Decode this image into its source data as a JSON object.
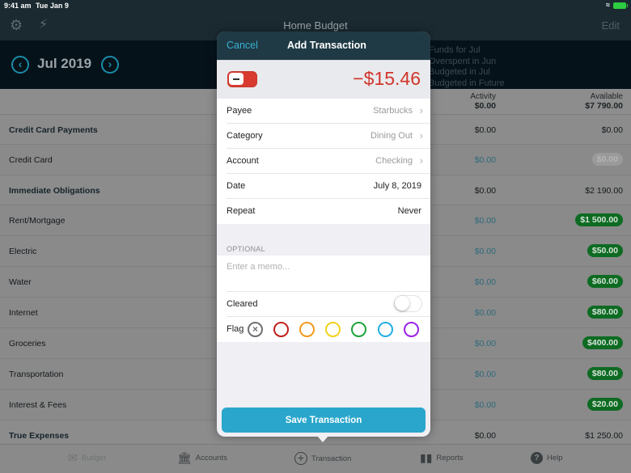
{
  "status_bar": {
    "time": "9:41 am",
    "date": "Tue Jan 9",
    "wifi_icon": "wifi-icon",
    "battery_icon": "battery-charging-icon"
  },
  "nav": {
    "title": "Home Budget",
    "edit_label": "Edit",
    "settings_icon": "gear-icon",
    "quick_icon": "lightning-icon"
  },
  "month": {
    "label": "Jul 2019",
    "prev_icon": "chevron-left-circle-icon",
    "next_icon": "chevron-right-circle-icon"
  },
  "summary_lines": [
    "Funds for Jul",
    "Overspent in Jun",
    "Budgeted in Jul",
    "Budgeted in Future"
  ],
  "columns": {
    "activity": {
      "label": "Activity",
      "total": "$0.00"
    },
    "available": {
      "label": "Available",
      "total": "$7 790.00"
    }
  },
  "rows": [
    {
      "type": "group",
      "name": "Credit Card Payments",
      "activity": "$0.00",
      "available": "$0.00",
      "pill": "none"
    },
    {
      "type": "item",
      "name": "Credit Card",
      "activity": "$0.00",
      "available": "$0.00",
      "pill": "gray"
    },
    {
      "type": "group",
      "name": "Immediate Obligations",
      "activity": "$0.00",
      "available": "$2 190.00",
      "pill": "none"
    },
    {
      "type": "item",
      "name": "Rent/Mortgage",
      "activity": "$0.00",
      "available": "$1 500.00",
      "pill": "green"
    },
    {
      "type": "item",
      "name": "Electric",
      "activity": "$0.00",
      "available": "$50.00",
      "pill": "green"
    },
    {
      "type": "item",
      "name": "Water",
      "activity": "$0.00",
      "available": "$60.00",
      "pill": "green"
    },
    {
      "type": "item",
      "name": "Internet",
      "activity": "$0.00",
      "available": "$80.00",
      "pill": "green"
    },
    {
      "type": "item",
      "name": "Groceries",
      "activity": "$0.00",
      "available": "$400.00",
      "pill": "green"
    },
    {
      "type": "item",
      "name": "Transportation",
      "activity": "$0.00",
      "available": "$80.00",
      "pill": "green"
    },
    {
      "type": "item",
      "name": "Interest & Fees",
      "activity": "$0.00",
      "available": "$20.00",
      "pill": "green"
    },
    {
      "type": "group",
      "name": "True Expenses",
      "activity": "$0.00",
      "available": "$1 250.00",
      "pill": "none"
    }
  ],
  "tabs": [
    {
      "label": "Budget",
      "icon": "envelope-icon"
    },
    {
      "label": "Accounts",
      "icon": "bank-icon"
    },
    {
      "label": "Transaction",
      "icon": "plus-circle-icon"
    },
    {
      "label": "Reports",
      "icon": "bar-chart-icon"
    },
    {
      "label": "Help",
      "icon": "help-circle-icon"
    }
  ],
  "modal": {
    "cancel_label": "Cancel",
    "title": "Add Transaction",
    "amount": "−$15.46",
    "amount_sign": "outflow",
    "fields": [
      {
        "label": "Payee",
        "value": "Starbucks",
        "chevron": true
      },
      {
        "label": "Category",
        "value": "Dining Out",
        "chevron": true
      },
      {
        "label": "Account",
        "value": "Checking",
        "chevron": true
      },
      {
        "label": "Date",
        "value": "July 8, 2019",
        "chevron": false
      },
      {
        "label": "Repeat",
        "value": "Never",
        "chevron": false
      }
    ],
    "optional_label": "OPTIONAL",
    "memo_placeholder": "Enter a memo...",
    "memo_value": "",
    "cleared_label": "Cleared",
    "cleared_on": false,
    "flag_label": "Flag",
    "flags": [
      {
        "name": "none",
        "color": "#6f6f73"
      },
      {
        "name": "red",
        "color": "#c1201b"
      },
      {
        "name": "orange",
        "color": "#f39a1d"
      },
      {
        "name": "yellow",
        "color": "#f1d21c"
      },
      {
        "name": "green",
        "color": "#1ea33a"
      },
      {
        "name": "blue",
        "color": "#22aee6"
      },
      {
        "name": "purple",
        "color": "#9a22e6"
      }
    ],
    "save_label": "Save Transaction"
  },
  "colors": {
    "accent": "#2aa6cc",
    "negative": "#d0352b",
    "available_green": "#0d6b22",
    "modal_header": "#1f3a44"
  }
}
